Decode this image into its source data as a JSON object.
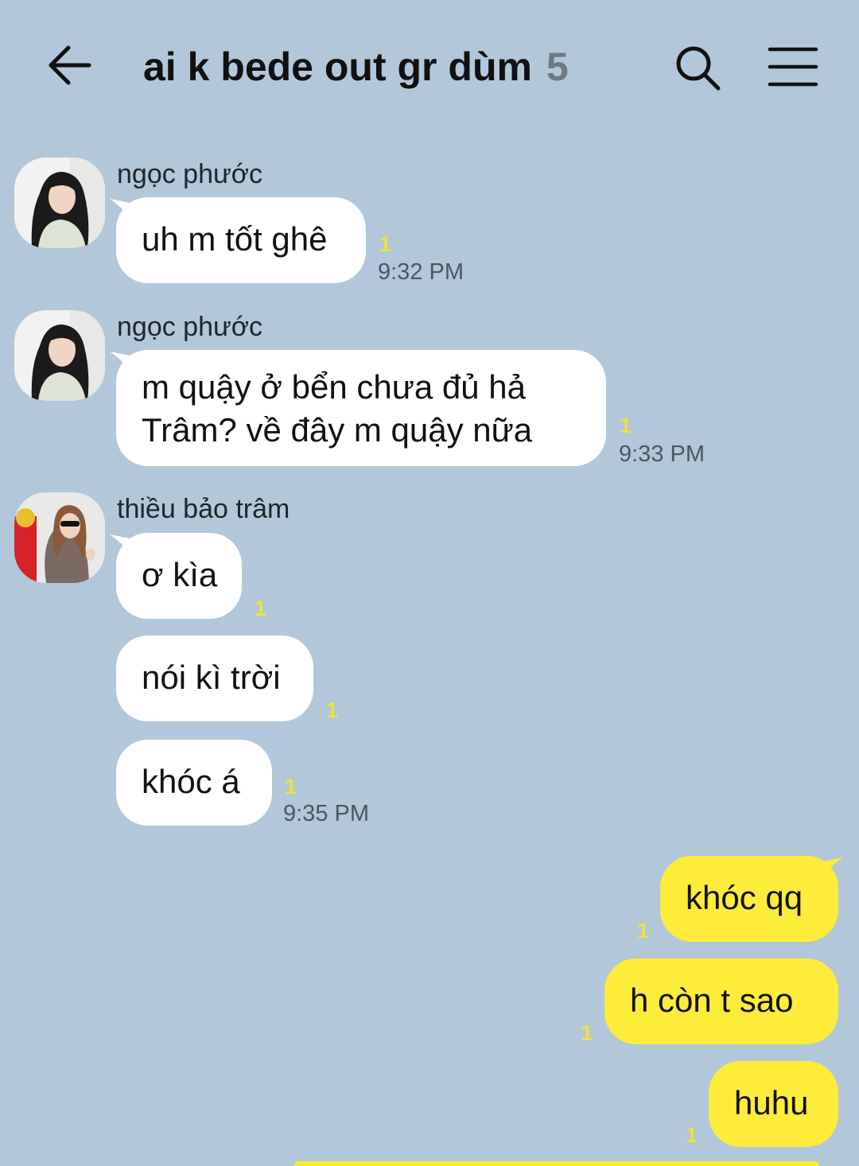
{
  "header": {
    "title": "ai k bede out gr dùm",
    "member_count": "5"
  },
  "messages": [
    {
      "sender": "ngọc phước",
      "text": "uh m tốt ghê",
      "unread": "1",
      "time": "9:32 PM"
    },
    {
      "sender": "ngọc phước",
      "line1": "m quậy ở bển chưa đủ hả",
      "line2": "Trâm? về đây m quậy nữa",
      "unread": "1",
      "time": "9:33 PM"
    },
    {
      "sender": "thiều bảo trâm",
      "text": "ơ kìa",
      "unread": "1"
    },
    {
      "text": "nói kì trời",
      "unread": "1"
    },
    {
      "text": "khóc á",
      "unread": "1",
      "time": "9:35 PM"
    },
    {
      "text": "khóc qq",
      "unread": "1"
    },
    {
      "text": "h còn t sao",
      "unread": "1"
    },
    {
      "text": "huhu",
      "unread": "1"
    }
  ],
  "colors": {
    "background": "#b2c7da",
    "incoming_bubble": "#ffffff",
    "outgoing_bubble": "#fdec3a",
    "unread_indicator": "#efe23c"
  },
  "icons": {
    "back": "arrow-left-icon",
    "search": "magnifier-icon",
    "menu": "hamburger-icon"
  }
}
